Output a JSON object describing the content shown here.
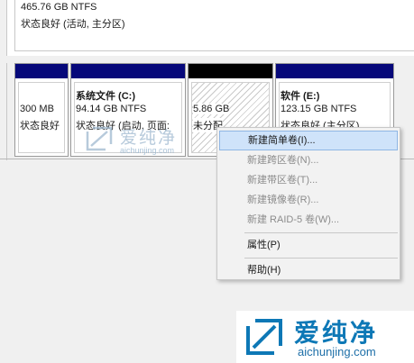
{
  "top_partition": {
    "size_fs": "465.76 GB NTFS",
    "status": "状态良好 (活动, 主分区)"
  },
  "partitions": [
    {
      "name": "",
      "size": "300 MB",
      "status": "状态良好"
    },
    {
      "name": "系统文件 (C:)",
      "size": "94.14 GB NTFS",
      "status": "状态良好 (启动, 页面:"
    },
    {
      "name": "",
      "size": "5.86 GB",
      "status": "未分配"
    },
    {
      "name": "软件 (E:)",
      "size": "123.15 GB NTFS",
      "status": "状态良好 (主分区)"
    }
  ],
  "context_menu": {
    "items": [
      {
        "label": "新建简单卷(I)...",
        "enabled": true,
        "highlighted": true
      },
      {
        "label": "新建跨区卷(N)...",
        "enabled": false
      },
      {
        "label": "新建带区卷(T)...",
        "enabled": false
      },
      {
        "label": "新建镜像卷(R)...",
        "enabled": false
      },
      {
        "label": "新建 RAID-5 卷(W)...",
        "enabled": false
      },
      {
        "label": "属性(P)",
        "enabled": true
      },
      {
        "label": "帮助(H)",
        "enabled": true
      }
    ]
  },
  "watermark": {
    "name": "爱纯净",
    "url": "aichunjing.com",
    "color": "#0d78b6"
  },
  "colors": {
    "partition_stripe": "#06087a",
    "unallocated_stripe": "#000000",
    "menu_highlight": "#cfe3fa"
  }
}
